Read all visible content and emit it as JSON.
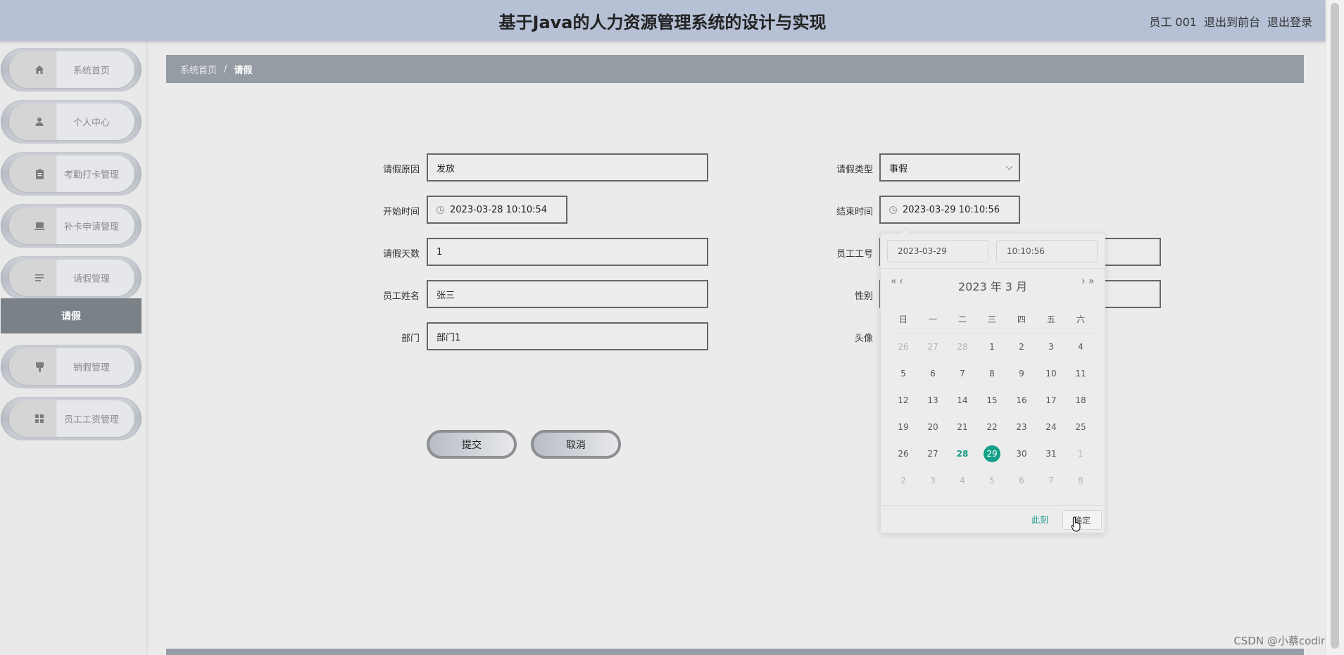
{
  "header": {
    "title": "基于Java的人力资源管理系统的设计与实现",
    "user": "员工 001",
    "back_to_front": "退出到前台",
    "logout": "退出登录"
  },
  "sidebar": {
    "items": [
      {
        "label": "系统首页",
        "icon": "home-icon"
      },
      {
        "label": "个人中心",
        "icon": "person-icon"
      },
      {
        "label": "考勤打卡管理",
        "icon": "clipboard-icon"
      },
      {
        "label": "补卡申请管理",
        "icon": "laptop-icon"
      },
      {
        "label": "请假管理",
        "icon": "list-icon"
      },
      {
        "label": "销假管理",
        "icon": "brush-icon"
      },
      {
        "label": "员工工资管理",
        "icon": "grid-icon"
      }
    ],
    "active_submenu": "请假"
  },
  "breadcrumb": {
    "home": "系统首页",
    "separator": "/",
    "current": "请假"
  },
  "form": {
    "reason_label": "请假原因",
    "reason_value": "发放",
    "type_label": "请假类型",
    "type_value": "事假",
    "start_label": "开始时间",
    "start_value": "2023-03-28 10:10:54",
    "end_label": "结束时间",
    "end_value": "2023-03-29 10:10:56",
    "days_label": "请假天数",
    "days_value": "1",
    "emp_id_label": "员工工号",
    "name_label": "员工姓名",
    "name_value": "张三",
    "gender_label": "性别",
    "dept_label": "部门",
    "dept_value": "部门1",
    "avatar_label": "头像",
    "submit_label": "提交",
    "cancel_label": "取消"
  },
  "picker": {
    "date_value": "2023-03-29",
    "time_value": "10:10:56",
    "prev_year": "«",
    "prev_month": "‹",
    "next_month": "›",
    "next_year": "»",
    "month_title": "2023 年  3 月",
    "weekdays": [
      "日",
      "一",
      "二",
      "三",
      "四",
      "五",
      "六"
    ],
    "weeks": [
      [
        "26",
        "27",
        "28",
        "1",
        "2",
        "3",
        "4"
      ],
      [
        "5",
        "6",
        "7",
        "8",
        "9",
        "10",
        "11"
      ],
      [
        "12",
        "13",
        "14",
        "15",
        "16",
        "17",
        "18"
      ],
      [
        "19",
        "20",
        "21",
        "22",
        "23",
        "24",
        "25"
      ],
      [
        "26",
        "27",
        "28",
        "29",
        "30",
        "31",
        "1"
      ],
      [
        "2",
        "3",
        "4",
        "5",
        "6",
        "7",
        "8"
      ]
    ],
    "today": "28",
    "selected": "29",
    "accent_color": "#14a088",
    "now_label": "此刻",
    "ok_label": "确定"
  },
  "watermark": "CSDN @小蔡coding"
}
